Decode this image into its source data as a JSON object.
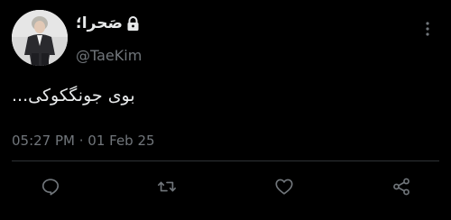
{
  "tweet": {
    "author": {
      "display_name": "صَحرا؛",
      "handle": "@TaeKim",
      "verified_lock": true
    },
    "text": "بوی جونگکوکی...",
    "timestamp": "05:27 PM · 01 Feb 25"
  },
  "icons": {
    "more": "more-vertical-icon",
    "reply": "reply-icon",
    "retweet": "retweet-icon",
    "like": "heart-icon",
    "share": "share-icon",
    "lock": "lock-icon"
  },
  "colors": {
    "background": "#000000",
    "primary_text": "#e7e9ea",
    "secondary_text": "#71767b",
    "divider": "#2f3336",
    "icon": "#71767b"
  }
}
